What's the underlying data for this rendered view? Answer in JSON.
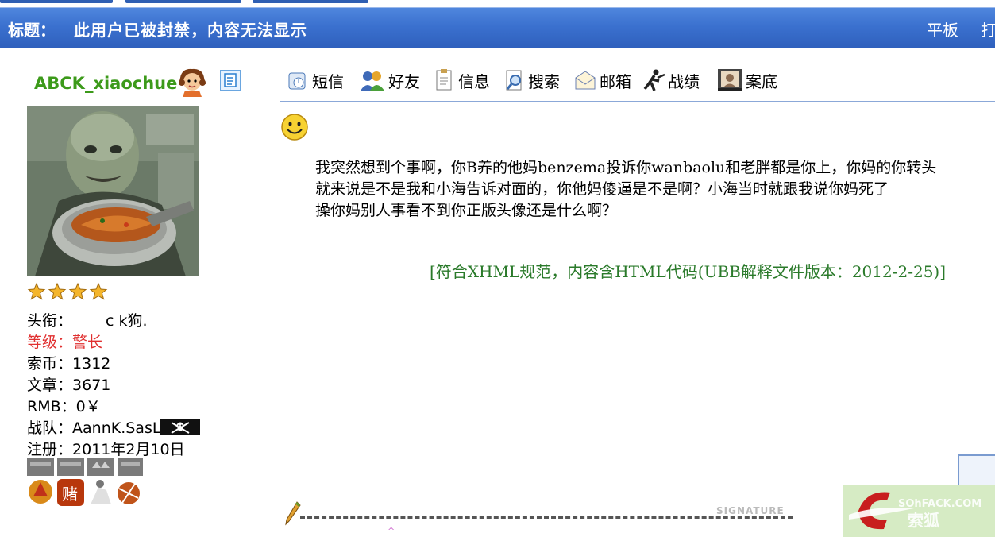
{
  "title_bar": {
    "label": "标题：",
    "text": "此用户已被封禁，内容无法显示",
    "flat_view": "平板",
    "print": "打"
  },
  "user": {
    "username": "ABCK_xiaochue",
    "profile": {
      "title_label": "头衔：",
      "title_value": "c k狗.",
      "level_label": "等级：",
      "level_value": "警长",
      "coins_label": "索币：",
      "coins_value": "1312",
      "posts_label": "文章：",
      "posts_value": "3671",
      "rmb_label": "RMB：",
      "rmb_value": "0￥",
      "team_label": "战队：",
      "team_value": "AannK.SasL",
      "registered_label": "注册：",
      "registered_value": "2011年2月10日"
    },
    "stars": 4
  },
  "toolbar": {
    "sms": "短信",
    "friends": "好友",
    "info": "信息",
    "search": "搜索",
    "mailbox": "邮箱",
    "record": "战绩",
    "case": "案底"
  },
  "post": {
    "paragraph_1": "我突然想到个事啊，你B养的他妈benzema投诉你wanbaolu和老胖都是你上，你妈的你转头就来说是不是我和小海告诉对面的，你他妈傻逼是不是啊？小海当时就跟我说你妈死了",
    "paragraph_2": "操你妈别人事看不到你正版头像还是什么啊？",
    "ubb_note": "[符合XHML规范，内容含HTML代码(UBB解释文件版本：2012-2-25)]",
    "signature_label": "SIGNATURE"
  },
  "colors": {
    "title_bar": "#3b71cf",
    "username": "#3c9a1a",
    "level": "#e03030",
    "ubb_note": "#2a7a2a",
    "divider": "#8ba8d8"
  },
  "icons": [
    "face-icon",
    "doc-icon",
    "star-icon",
    "pirate-flag-icon",
    "medal-icon",
    "sms-icon",
    "friends-icon",
    "info-icon",
    "search-icon",
    "mail-icon",
    "record-icon",
    "case-icon",
    "smiley-icon",
    "pencil-icon"
  ]
}
